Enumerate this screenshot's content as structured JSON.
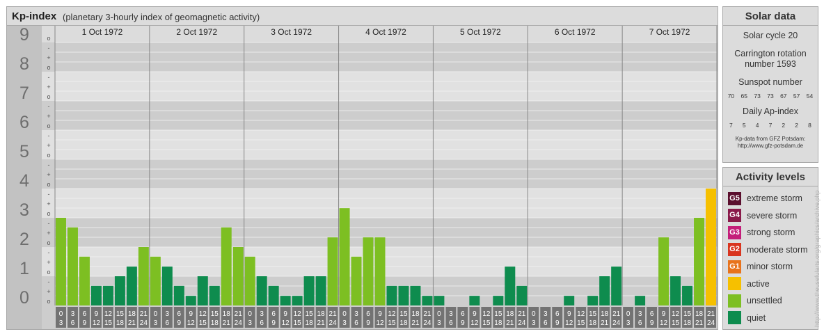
{
  "header": {
    "title": "Kp-index",
    "subtitle": "(planetary 3-hourly index of geomagnetic activity)"
  },
  "chart_data": {
    "type": "bar",
    "ylim": [
      0,
      9
    ],
    "y_major_ticks": [
      "0",
      "1",
      "2",
      "3",
      "4",
      "5",
      "6",
      "7",
      "8",
      "9"
    ],
    "y_minor_ticks": [
      "o",
      "+",
      "-"
    ],
    "days": [
      "1 Oct 1972",
      "2 Oct 1972",
      "3 Oct 1972",
      "4 Oct 1972",
      "5 Oct 1972",
      "6 Oct 1972",
      "7 Oct 1972"
    ],
    "intervals": [
      [
        "0",
        "3"
      ],
      [
        "3",
        "6"
      ],
      [
        "6",
        "9"
      ],
      [
        "9",
        "12"
      ],
      [
        "12",
        "15"
      ],
      [
        "15",
        "18"
      ],
      [
        "18",
        "21"
      ],
      [
        "21",
        "24"
      ]
    ],
    "values": [
      [
        3.0,
        2.67,
        1.67,
        0.67,
        0.67,
        1.0,
        1.33,
        2.0
      ],
      [
        1.67,
        1.33,
        0.67,
        0.33,
        1.0,
        0.67,
        2.67,
        2.0
      ],
      [
        1.67,
        1.0,
        0.67,
        0.33,
        0.33,
        1.0,
        1.0,
        2.33
      ],
      [
        3.33,
        1.67,
        2.33,
        2.33,
        0.67,
        0.67,
        0.67,
        0.33
      ],
      [
        0.33,
        0.0,
        0.0,
        0.33,
        0.0,
        0.33,
        1.33,
        0.67
      ],
      [
        0.0,
        0.0,
        0.0,
        0.33,
        0.0,
        0.33,
        1.0,
        1.33
      ],
      [
        0.0,
        0.33,
        0.0,
        2.33,
        1.0,
        0.67,
        3.0,
        4.0
      ]
    ],
    "colors": {
      "quiet": "#0e8c4e",
      "unsettled": "#7dbf22",
      "active": "#f6c000"
    }
  },
  "solar": {
    "heading": "Solar data",
    "cycle": "Solar cycle 20",
    "carrington": "Carrington rotation number 1593",
    "sunspot_label": "Sunspot number",
    "sunspots": [
      "70",
      "65",
      "73",
      "73",
      "67",
      "57",
      "54"
    ],
    "ap_label": "Daily Ap-index",
    "ap_values": [
      "7",
      "5",
      "4",
      "7",
      "2",
      "2",
      "8"
    ],
    "source_line1": "Kp-data from GFZ Potsdam:",
    "source_line2": "http://www.gfz-potsdam.de"
  },
  "activity": {
    "heading": "Activity levels",
    "levels": [
      {
        "badge": "G5",
        "label": "extreme storm",
        "color": "#5b0f2e"
      },
      {
        "badge": "G4",
        "label": "severe storm",
        "color": "#8a1a4a"
      },
      {
        "badge": "G3",
        "label": "strong storm",
        "color": "#c41e7a"
      },
      {
        "badge": "G2",
        "label": "moderate storm",
        "color": "#d9351f"
      },
      {
        "badge": "G1",
        "label": "minor storm",
        "color": "#e8731c"
      },
      {
        "badge": "",
        "label": "active",
        "color": "#f6c000"
      },
      {
        "badge": "",
        "label": "unsettled",
        "color": "#7dbf22"
      },
      {
        "badge": "",
        "label": "quiet",
        "color": "#0e8c4e"
      }
    ]
  },
  "watermark": "http://www.theusefularts.org/graphics/archive.php"
}
